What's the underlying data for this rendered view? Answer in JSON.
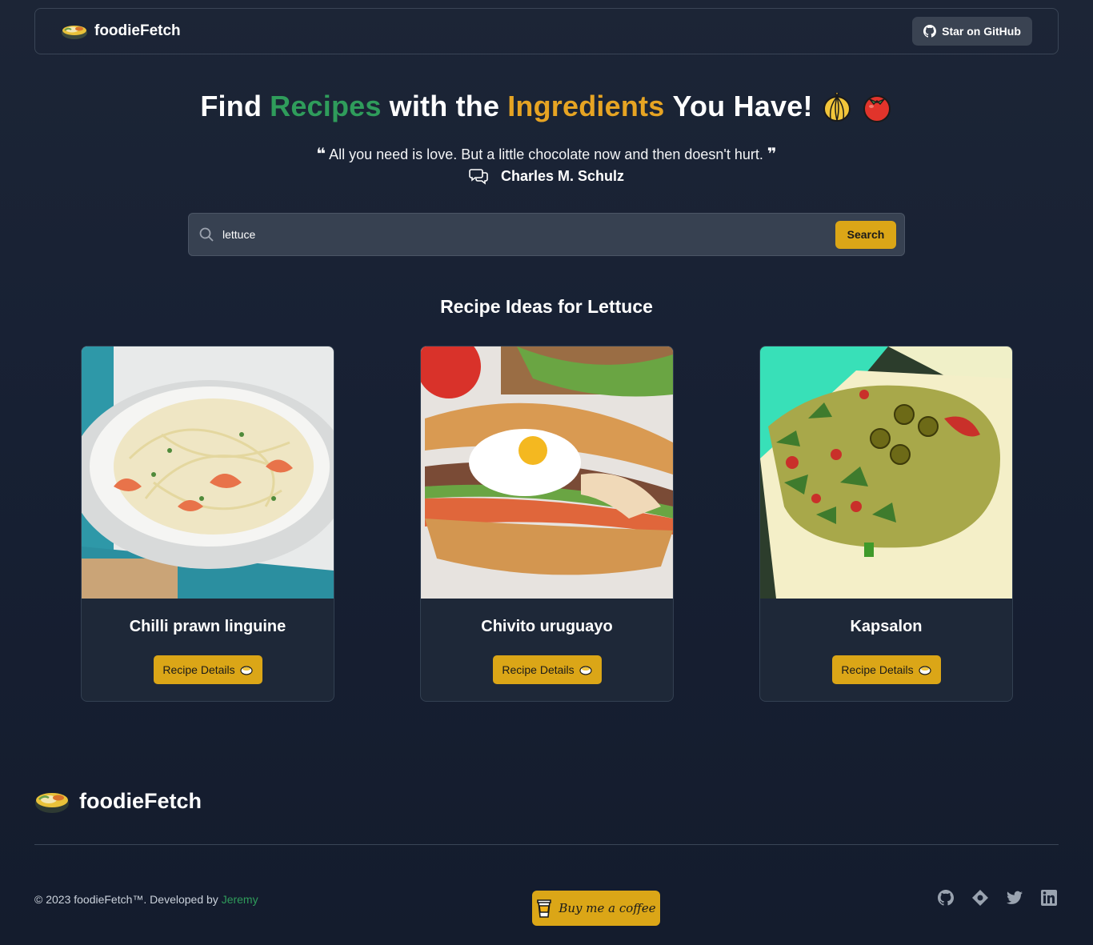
{
  "nav": {
    "brand": "foodieFetch",
    "github_button": "Star on GitHub"
  },
  "hero": {
    "title_part1": "Find",
    "title_highlight1": "Recipes",
    "title_part2": "with the",
    "title_highlight2": "Ingredients",
    "title_part3": "You Have!",
    "quote_open": "❝",
    "quote_text": "All you need is love. But a little chocolate now and then doesn't hurt.",
    "quote_close": "❞",
    "author": "Charles M. Schulz"
  },
  "search": {
    "value": "lettuce",
    "button": "Search"
  },
  "results": {
    "title": "Recipe Ideas for Lettuce",
    "cards": [
      {
        "title": "Chilli prawn linguine",
        "button": "Recipe Details"
      },
      {
        "title": "Chivito uruguayo",
        "button": "Recipe Details"
      },
      {
        "title": "Kapsalon",
        "button": "Recipe Details"
      }
    ]
  },
  "footer": {
    "brand": "foodieFetch",
    "copyright": "© 2023 foodieFetch™. Developed by",
    "developer": "Jeremy",
    "coffee_button": "Buy me a coffee",
    "socials": [
      "github-icon",
      "website-icon",
      "twitter-icon",
      "linkedin-icon"
    ]
  },
  "colors": {
    "accent": "#dba617",
    "green": "#2f9c5b",
    "orange": "#e6a423",
    "background": "#172033"
  }
}
